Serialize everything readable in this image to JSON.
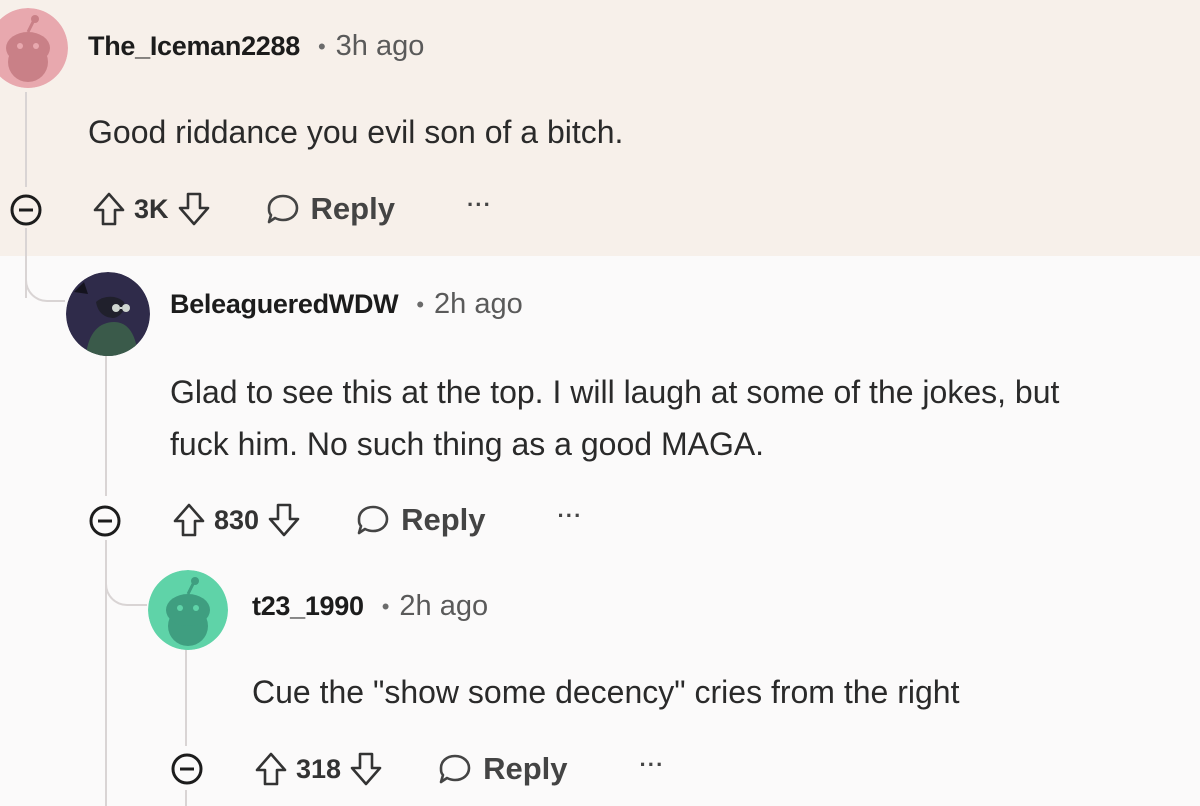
{
  "comments": [
    {
      "username": "The_Iceman2288",
      "separator": "•",
      "time": "3h ago",
      "body": [
        "Good riddance you evil son of a bitch."
      ],
      "score": "3K",
      "reply_label": "Reply",
      "more_label": "···",
      "avatar_color": "#e8a8ae"
    },
    {
      "username": "BeleagueredWDW",
      "separator": "•",
      "time": "2h ago",
      "body": [
        "Glad to see this at the top. I will laugh at some of the jokes, but",
        "fuck him. No such thing as a good MAGA."
      ],
      "score": "830",
      "reply_label": "Reply",
      "more_label": "···",
      "avatar_color": "#2f2b4a"
    },
    {
      "username": "t23_1990",
      "separator": "•",
      "time": "2h ago",
      "body": [
        "Cue the \"show some decency\" cries from the right"
      ],
      "score": "318",
      "reply_label": "Reply",
      "more_label": "···",
      "avatar_color": "#5fd3a8"
    }
  ],
  "colors": {
    "highlight": "#f7f0ea",
    "background": "#fbfafa",
    "thread_line": "#d9d4d4",
    "text": "#1c1c1c"
  }
}
